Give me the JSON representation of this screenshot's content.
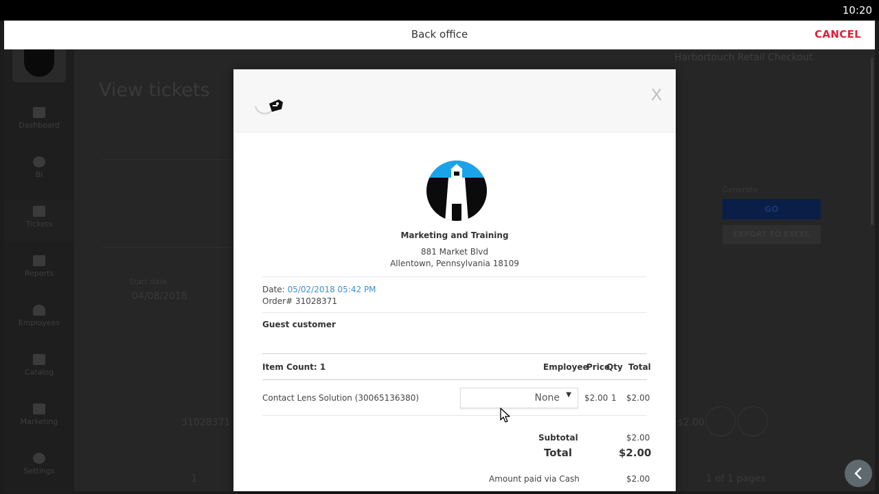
{
  "status_bar": {
    "time": "10:20"
  },
  "app_bar": {
    "title": "Back office",
    "cancel_label": "CANCEL"
  },
  "background": {
    "page_title": "View tickets",
    "app_name": "Harbortouch Retail Checkout",
    "nav": [
      {
        "label": "Dashboard",
        "icon": "dashboard-icon"
      },
      {
        "label": "BI",
        "icon": "lightbulb-icon"
      },
      {
        "label": "Tickets",
        "icon": "tickets-icon"
      },
      {
        "label": "Reports",
        "icon": "bar-chart-icon"
      },
      {
        "label": "Employees",
        "icon": "person-icon"
      },
      {
        "label": "Catalog",
        "icon": "list-icon"
      },
      {
        "label": "Marketing",
        "icon": "tag-icon"
      },
      {
        "label": "Settings",
        "icon": "gear-icon"
      }
    ],
    "start_date_label": "Start date",
    "start_date_value": "04/08/2018",
    "generate_label": "Generate",
    "go_label": "GO",
    "export_label": "EXPORT TO EXCEL",
    "row_order": "31028371",
    "row_total": "$2.00",
    "pager": "1 of 1 pages",
    "pager_num": "1"
  },
  "modal": {
    "close_label": "X",
    "store": {
      "name": "Marketing and Training",
      "address_line1": "881 Market Blvd",
      "address_line2": "Allentown, Pennsylvania 18109"
    },
    "date_label": "Date:",
    "date_value": "05/02/2018 05:42 PM",
    "order_label": "Order#",
    "order_number": "31028371",
    "customer": "Guest customer",
    "table": {
      "item_count_label": "Item Count: 1",
      "col_employee": "Employee",
      "col_price": "Price",
      "col_qty": "Qty",
      "col_total": "Total",
      "items": [
        {
          "name": "Contact Lens Solution (30065136380)",
          "employee": "None",
          "price": "$2.00",
          "qty": "1",
          "total": "$2.00"
        }
      ]
    },
    "subtotal_label": "Subtotal",
    "subtotal_value": "$2.00",
    "total_label": "Total",
    "total_value": "$2.00",
    "paid_label": "Amount paid via Cash",
    "paid_value": "$2.00"
  },
  "colors": {
    "cancel": "#e0213a",
    "link": "#3b8fd4",
    "logo_blue": "#1aa3e8"
  }
}
